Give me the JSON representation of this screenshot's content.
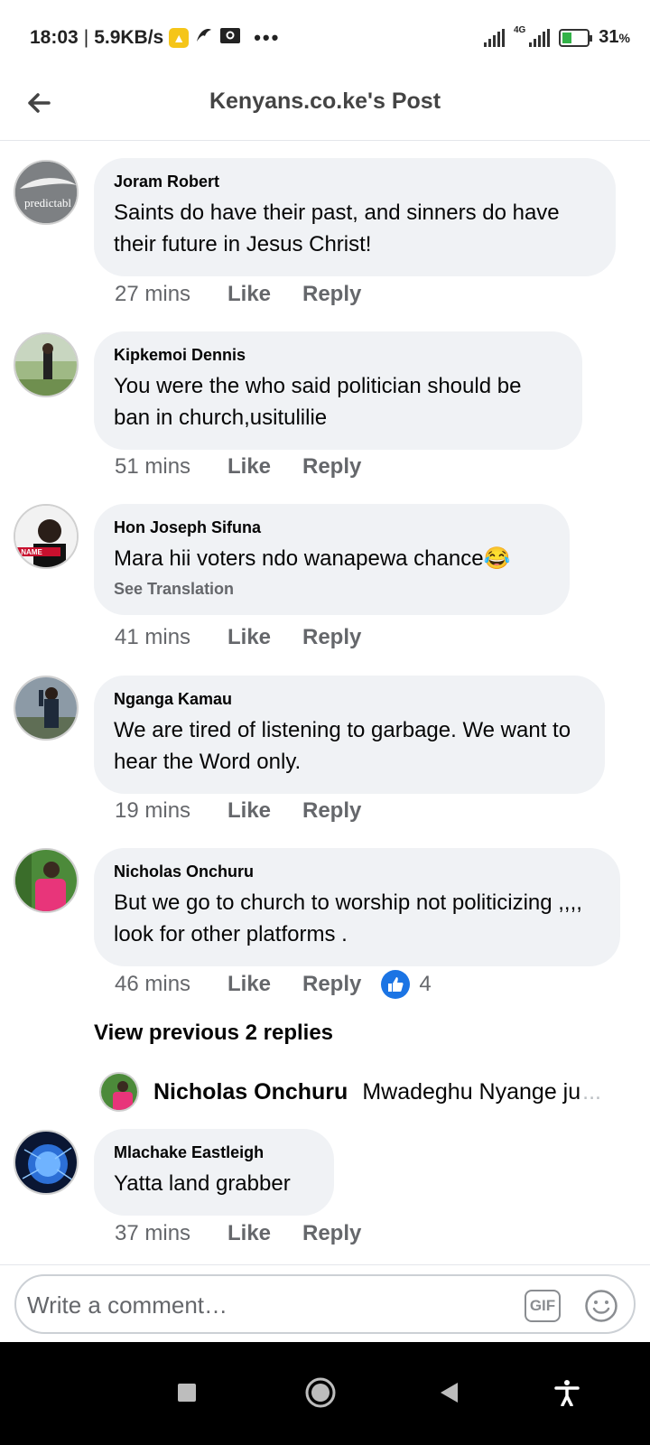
{
  "status_bar": {
    "time": "18:03",
    "separator": "|",
    "speed": "5.9KB/s",
    "network_type": "4G",
    "battery": "31",
    "battery_unit": "%"
  },
  "header": {
    "title": "Kenyans.co.ke's Post"
  },
  "comments": [
    {
      "author": "Joram Robert",
      "text": "Saints do have their past, and sinners do have their future in Jesus Christ!",
      "time": "27 mins",
      "like": "Like",
      "reply": "Reply"
    },
    {
      "author": "Kipkemoi Dennis",
      "text": "You were the who said politician should be ban in church,usitulilie",
      "time": "51 mins",
      "like": "Like",
      "reply": "Reply"
    },
    {
      "author": "Hon Joseph Sifuna",
      "text": "Mara hii voters ndo wanapewa chance😂",
      "see_translation": "See Translation",
      "time": "41 mins",
      "like": "Like",
      "reply": "Reply"
    },
    {
      "author": "Nganga Kamau",
      "text": "We are tired of listening to garbage. We want to hear the Word only.",
      "time": "19 mins",
      "like": "Like",
      "reply": "Reply"
    },
    {
      "author": "Nicholas Onchuru",
      "text": "But we go to church to worship not politicizing ,,,, look for other platforms .",
      "time": "46 mins",
      "like": "Like",
      "reply": "Reply",
      "reaction_count": "4"
    },
    {
      "author": "Mlachake Eastleigh",
      "text": "Yatta land grabber",
      "time": "37 mins",
      "like": "Like",
      "reply": "Reply"
    }
  ],
  "view_previous": "View previous 2 replies",
  "reply_preview": {
    "author": "Nicholas Onchuru",
    "text": "Mwadeghu Nyange ju",
    "ellipsis": "..."
  },
  "composer": {
    "placeholder": "Write a comment…",
    "gif_label": "GIF"
  },
  "avatar_text": {
    "joram": "predictabl",
    "sifuna": "NAME"
  },
  "colors": {
    "bubble": "#f0f2f5",
    "meta_text": "#65676b",
    "like_blue": "#1b74e4",
    "nav_bar": "#000000"
  }
}
